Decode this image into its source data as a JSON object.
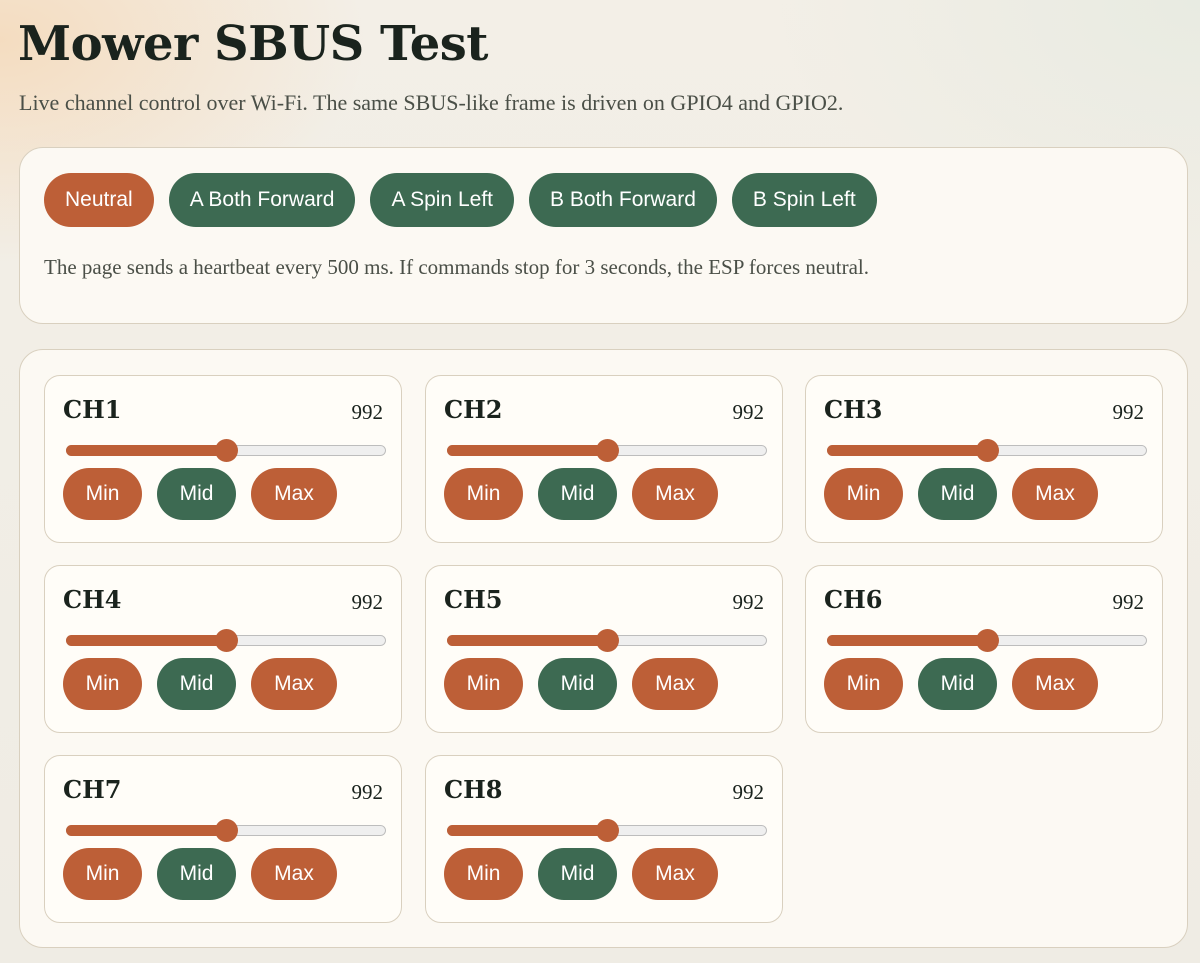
{
  "page": {
    "title": "Mower SBUS Test",
    "subtitle": "Live channel control over Wi-Fi. The same SBUS-like frame is driven on GPIO4 and GPIO2."
  },
  "presets": {
    "buttons": [
      {
        "label": "Neutral",
        "style": "rust"
      },
      {
        "label": "A Both Forward",
        "style": "green"
      },
      {
        "label": "A Spin Left",
        "style": "green"
      },
      {
        "label": "B Both Forward",
        "style": "green"
      },
      {
        "label": "B Spin Left",
        "style": "green"
      }
    ],
    "note": "The page sends a heartbeat every 500 ms. If commands stop for 3 seconds, the ESP forces neutral."
  },
  "channels": [
    {
      "label": "CH1",
      "value": "992",
      "slider_fraction": 0.5
    },
    {
      "label": "CH2",
      "value": "992",
      "slider_fraction": 0.5
    },
    {
      "label": "CH3",
      "value": "992",
      "slider_fraction": 0.5
    },
    {
      "label": "CH4",
      "value": "992",
      "slider_fraction": 0.5
    },
    {
      "label": "CH5",
      "value": "992",
      "slider_fraction": 0.5
    },
    {
      "label": "CH6",
      "value": "992",
      "slider_fraction": 0.5
    },
    {
      "label": "CH7",
      "value": "992",
      "slider_fraction": 0.5
    },
    {
      "label": "CH8",
      "value": "992",
      "slider_fraction": 0.5
    }
  ],
  "channel_buttons": {
    "min_label": "Min",
    "mid_label": "Mid",
    "max_label": "Max"
  },
  "colors": {
    "rust": "#bd5f37",
    "green": "#3d6a52",
    "panel": "#fcf9f3",
    "border": "#d9d0bf"
  }
}
